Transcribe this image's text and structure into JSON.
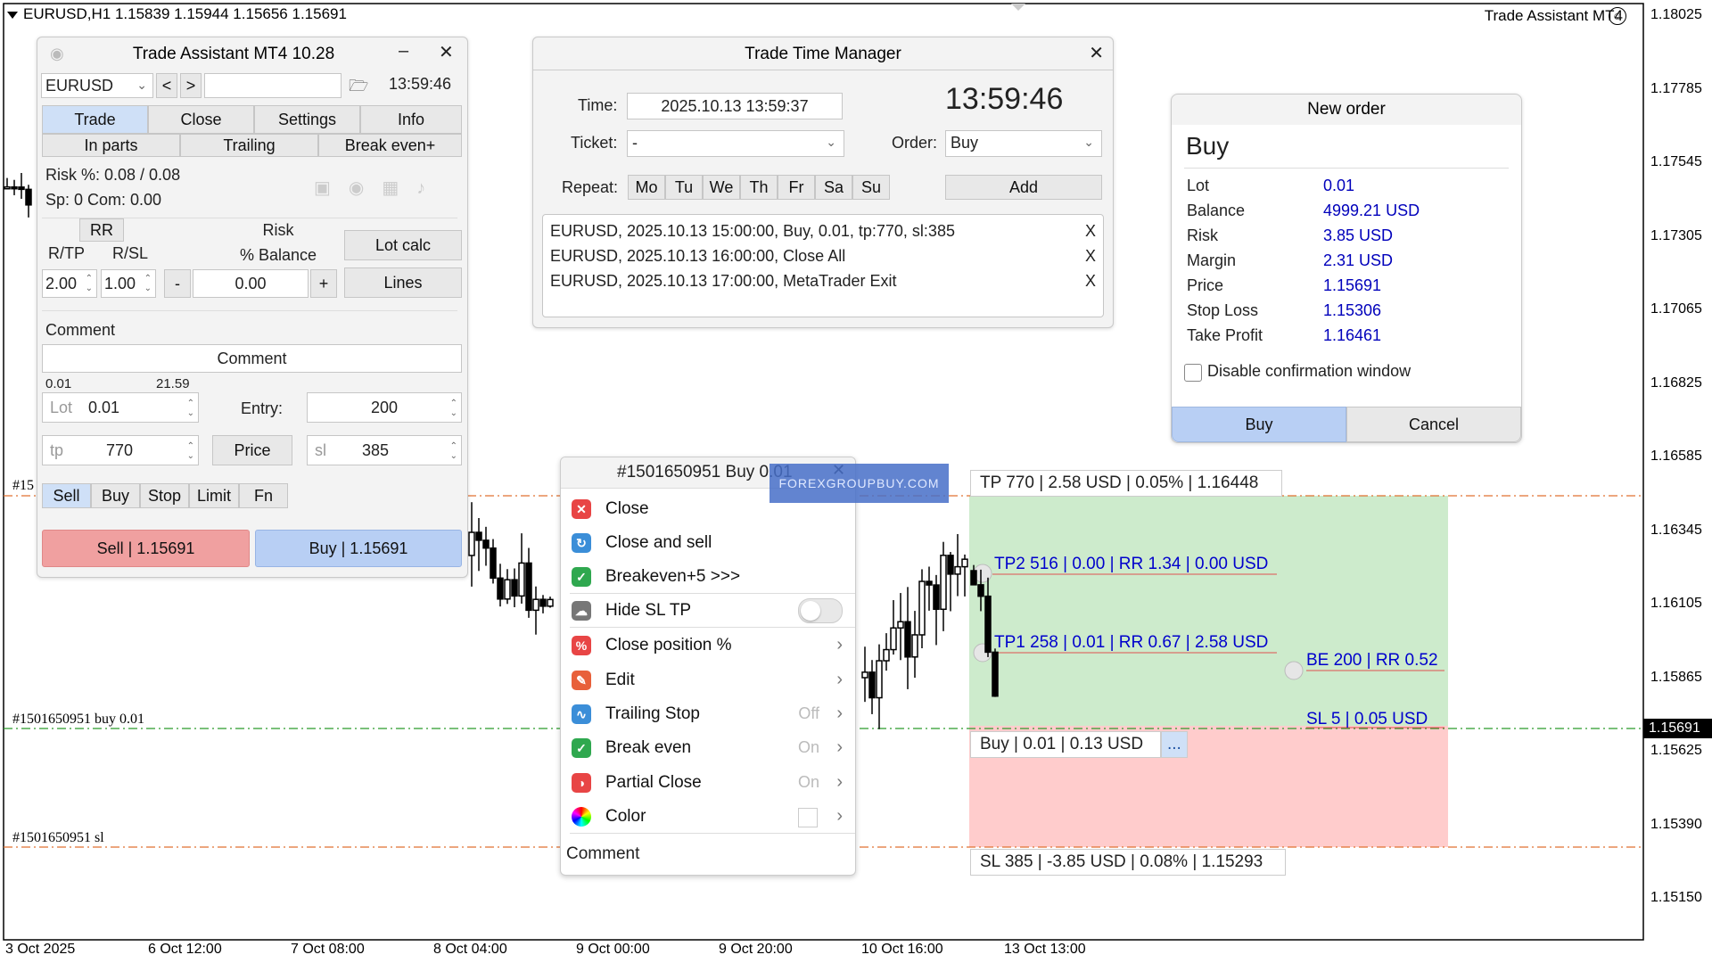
{
  "chart": {
    "title": "EURUSD,H1  1.15839 1.15944 1.15656 1.15691",
    "assistant_name": "Trade Assistant MT4",
    "price_labels": [
      "1.18025",
      "1.17785",
      "1.17545",
      "1.17305",
      "1.17065",
      "1.16825",
      "1.16585",
      "1.16345",
      "1.16105",
      "1.15865",
      "1.15625",
      "1.15390",
      "1.15150"
    ],
    "current_price": "1.15691",
    "time_labels": [
      "3 Oct 2025",
      "6 Oct 12:00",
      "7 Oct 08:00",
      "8 Oct 04:00",
      "9 Oct 00:00",
      "9 Oct 20:00",
      "10 Oct 16:00",
      "13 Oct 13:00"
    ],
    "line_labels": {
      "tp": "#15",
      "buy": "#1501650951 buy 0.01",
      "sl": "#1501650951 sl"
    },
    "colors": {
      "profit_zone": "#cdebcc",
      "loss_zone": "#ffcccc",
      "tp_line": "#e07030",
      "buy_line": "#2a9a2a"
    }
  },
  "trade_assistant": {
    "title": "Trade Assistant MT4 10.28",
    "symbol": "EURUSD",
    "prev": "<",
    "next": ">",
    "time": "13:59:46",
    "tabs_main": [
      "Trade",
      "Close",
      "Settings",
      "Info"
    ],
    "tabs_sub": [
      "In parts",
      "Trailing",
      "Break even+"
    ],
    "risk_pct": "Risk %: 0.08 /  0.08",
    "spread": "Sp: 0  Com: 0.00",
    "rr_label": "RR",
    "rtp_label": "R/TP",
    "rsl_label": "R/SL",
    "rtp_value": "2.00",
    "rsl_value": "1.00",
    "risk_title": "Risk",
    "risk_unit": "% Balance",
    "minus": "-",
    "plus": "+",
    "risk_value": "0.00",
    "lot_calc": "Lot calc",
    "lines": "Lines",
    "comment_label": "Comment",
    "comment_placeholder": "Comment",
    "lot_min": "0.01",
    "lot_max": "21.59",
    "lot_label": "Lot",
    "lot_value": "0.01",
    "entry_label": "Entry:",
    "entry_value": "200",
    "tp_label": "tp",
    "tp_value": "770",
    "price_btn": "Price",
    "sl_label": "sl",
    "sl_value": "385",
    "order_types": [
      "Sell",
      "Buy",
      "Stop",
      "Limit",
      "Fn"
    ],
    "sell_btn": "Sell  | 1.15691",
    "buy_btn": "Buy  | 1.15691"
  },
  "time_manager": {
    "title": "Trade Time Manager",
    "time_label": "Time:",
    "time_value": "2025.10.13 13:59:37",
    "clock": "13:59:46",
    "ticket_label": "Ticket:",
    "ticket_value": "-",
    "order_label": "Order:",
    "order_value": "Buy",
    "repeat_label": "Repeat:",
    "days": [
      "Mo",
      "Tu",
      "We",
      "Th",
      "Fr",
      "Sa",
      "Su"
    ],
    "add": "Add",
    "tasks": [
      {
        "text": "EURUSD, 2025.10.13 15:00:00, Buy, 0.01, tp:770, sl:385",
        "remove": "X"
      },
      {
        "text": "EURUSD, 2025.10.13 16:00:00, Close All",
        "remove": "X"
      },
      {
        "text": "EURUSD, 2025.10.13 17:00:00, MetaTrader Exit",
        "remove": "X"
      }
    ]
  },
  "new_order": {
    "title": "New order",
    "side": "Buy",
    "rows": [
      {
        "label": "Lot",
        "value": "0.01"
      },
      {
        "label": "Balance",
        "value": "4999.21 USD"
      },
      {
        "label": "Risk",
        "value": "3.85 USD"
      },
      {
        "label": "Margin",
        "value": "2.31 USD"
      },
      {
        "label": "Price",
        "value": "1.15691"
      },
      {
        "label": "Stop Loss",
        "value": "1.15306"
      },
      {
        "label": "Take Profit",
        "value": "1.16461"
      }
    ],
    "disable_confirm": "Disable confirmation window",
    "buy": "Buy",
    "cancel": "Cancel"
  },
  "context_menu": {
    "title": "#1501650951 Buy 0.01",
    "watermark": "FOREXGROUPBUY.COM",
    "items": [
      {
        "label": "Close",
        "icon": "close-icon",
        "color": "#e84545",
        "glyph": "✕"
      },
      {
        "label": "Close and sell",
        "icon": "close-sell-icon",
        "color": "#3b8ed8",
        "glyph": "↻"
      },
      {
        "label": "Breakeven+5 >>>",
        "icon": "shield-icon",
        "color": "#2fa84f",
        "glyph": "✓"
      },
      {
        "label": "Hide SL TP",
        "icon": "cloud-icon",
        "color": "#777777",
        "glyph": "☁"
      },
      {
        "label": "Close position %",
        "icon": "percent-icon",
        "color": "#e84545",
        "glyph": "%"
      },
      {
        "label": "Edit",
        "icon": "wrench-icon",
        "color": "#e8603a",
        "glyph": "✎"
      },
      {
        "label": "Trailing Stop",
        "state": "Off",
        "icon": "trailing-icon",
        "color": "#3b8ed8",
        "glyph": "∿"
      },
      {
        "label": "Break even",
        "state": "On",
        "icon": "break-even-icon",
        "color": "#2fa84f",
        "glyph": "✓"
      },
      {
        "label": "Partial Close",
        "state": "On",
        "icon": "partial-close-icon",
        "color": "#e84545",
        "glyph": "◑"
      },
      {
        "label": "Color",
        "icon": "color-wheel-icon",
        "color": "#cc44cc",
        "glyph": "●"
      }
    ],
    "comment": "Comment"
  },
  "trade_levels": {
    "tp_box": "TP 770 | 2.58 USD | 0.05% | 1.16448",
    "tp2": "TP2 516 | 0.00 | RR 1.34 | 0.00 USD",
    "tp1": "TP1 258 | 0.01 | RR 0.67 | 2.58 USD",
    "be": "BE 200 | RR 0.52",
    "sl5": "SL 5 | 0.05 USD",
    "buy_box": "Buy | 0.01 | 0.13 USD",
    "more": "...",
    "sl_box": "SL 385 | -3.85 USD | 0.08% | 1.15293"
  }
}
